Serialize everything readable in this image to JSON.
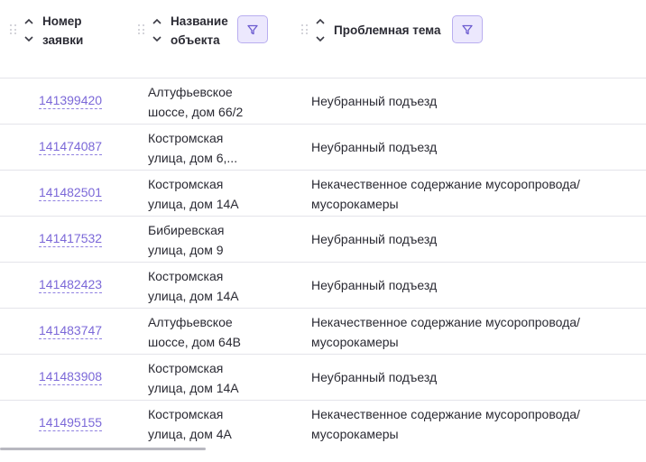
{
  "columns": {
    "number": {
      "label_line1": "Номер",
      "label_line2": "заявки"
    },
    "object": {
      "label_line1": "Название",
      "label_line2": "объекта"
    },
    "topic": {
      "label": "Проблемная тема"
    }
  },
  "rows": [
    {
      "number": "141399420",
      "object_line1": "Алтуфьевское",
      "object_line2": "шоссе, дом 66/2",
      "topic_line1": "Неубранный подъезд",
      "topic_line2": ""
    },
    {
      "number": "141474087",
      "object_line1": "Костромская",
      "object_line2": "улица, дом 6,...",
      "topic_line1": "Неубранный подъезд",
      "topic_line2": ""
    },
    {
      "number": "141482501",
      "object_line1": "Костромская",
      "object_line2": "улица, дом 14А",
      "topic_line1": "Некачественное содержание мусоропровода/",
      "topic_line2": "мусорокамеры"
    },
    {
      "number": "141417532",
      "object_line1": "Бибиревская",
      "object_line2": "улица, дом 9",
      "topic_line1": "Неубранный подъезд",
      "topic_line2": ""
    },
    {
      "number": "141482423",
      "object_line1": "Костромская",
      "object_line2": "улица, дом 14А",
      "topic_line1": "Неубранный подъезд",
      "topic_line2": ""
    },
    {
      "number": "141483747",
      "object_line1": "Алтуфьевское",
      "object_line2": "шоссе, дом 64В",
      "topic_line1": "Некачественное содержание мусоропровода/",
      "topic_line2": "мусорокамеры"
    },
    {
      "number": "141483908",
      "object_line1": "Костромская",
      "object_line2": "улица, дом 14А",
      "topic_line1": "Неубранный подъезд",
      "topic_line2": ""
    },
    {
      "number": "141495155",
      "object_line1": "Костромская",
      "object_line2": "улица, дом 4А",
      "topic_line1": "Некачественное содержание мусоропровода/",
      "topic_line2": "мусорокамеры"
    }
  ],
  "colors": {
    "link": "#7b68d8",
    "filter_bg": "#ece8fd",
    "filter_border": "#b9aef0",
    "divider": "#e4e4ea"
  },
  "icons": {
    "drag": "drag-handle-icon",
    "sort": "sort-arrows-icon",
    "filter": "filter-icon"
  }
}
